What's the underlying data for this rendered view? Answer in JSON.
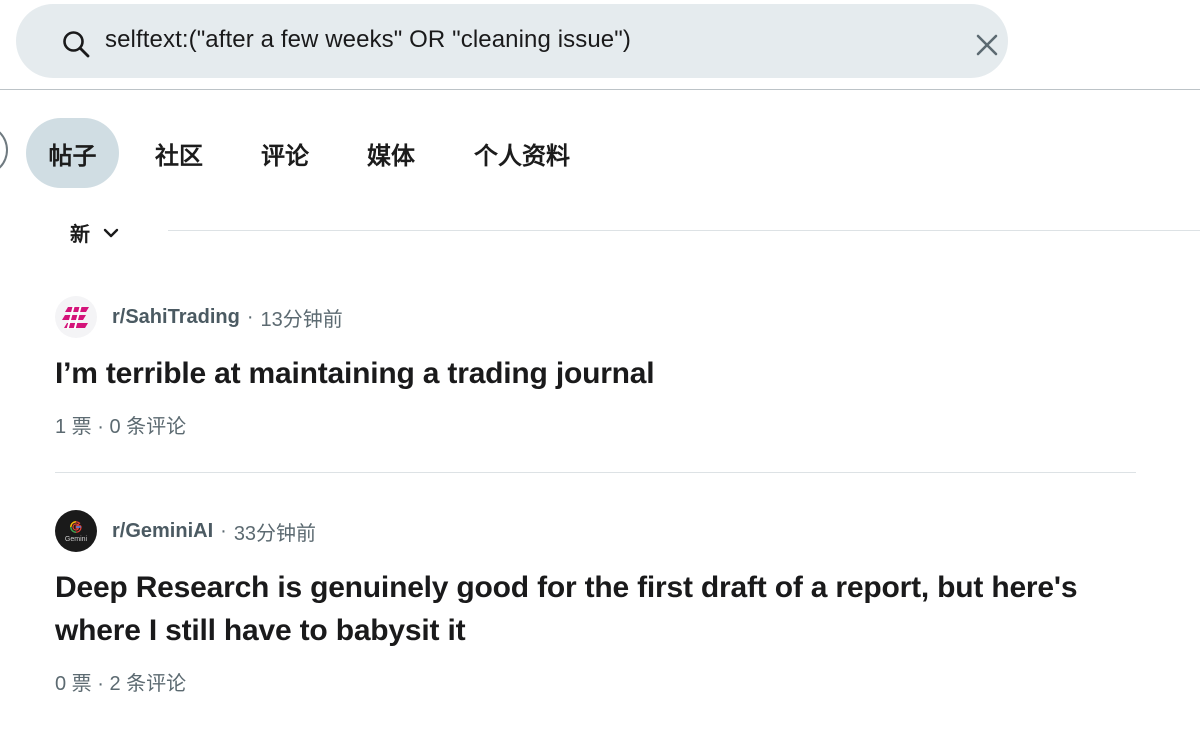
{
  "search": {
    "query": "selftext:(\"after a few weeks\" OR \"cleaning issue\")"
  },
  "tabs": [
    {
      "label": "帖子",
      "active": true
    },
    {
      "label": "社区",
      "active": false
    },
    {
      "label": "评论",
      "active": false
    },
    {
      "label": "媒体",
      "active": false
    },
    {
      "label": "个人资料",
      "active": false
    }
  ],
  "sort": {
    "label": "新"
  },
  "posts": [
    {
      "subreddit": "r/SahiTrading",
      "separator": "·",
      "time": "13分钟前",
      "title": "I’m terrible at maintaining a trading journal",
      "stats": "1 票 · 0 条评论",
      "avatar_icon": "sahi-logo-icon",
      "avatar_color": "#d4147a"
    },
    {
      "subreddit": "r/GeminiAI",
      "separator": "·",
      "time": "33分钟前",
      "title": "Deep Research is genuinely good for the first draft of a report, but here's where I still have to babysit it",
      "stats": "0 票 · 2 条评论",
      "avatar_icon": "gemini-logo-icon",
      "avatar_color": "#1a1a1a",
      "avatar_caption": "Gemini"
    }
  ]
}
